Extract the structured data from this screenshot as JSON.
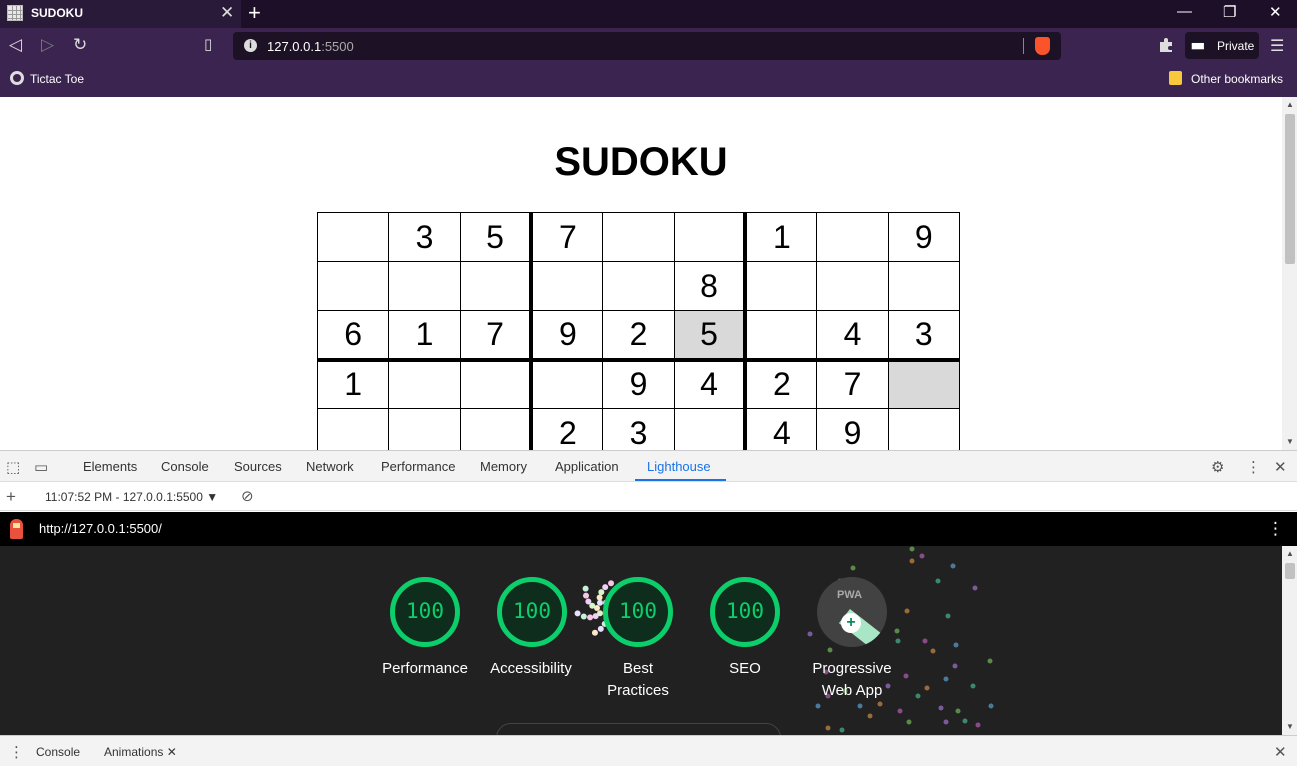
{
  "browser": {
    "tab_title": "SUDOKU",
    "tab_close": "✕",
    "new_tab": "+",
    "url_host": "127.0.0.1",
    "url_port": ":5500",
    "private_label": "Private",
    "bookmark_left": "Tictac Toe",
    "bookmark_right": "Other bookmarks"
  },
  "page": {
    "title": "SUDOKU",
    "rows": [
      [
        "",
        "3",
        "5",
        "7",
        "",
        "",
        "1",
        "",
        "9"
      ],
      [
        "",
        "",
        "",
        "",
        "",
        "8",
        "",
        "",
        ""
      ],
      [
        "6",
        "1",
        "7",
        "9",
        "2",
        "5",
        "",
        "4",
        "3"
      ],
      [
        "1",
        "",
        "",
        "",
        "9",
        "4",
        "2",
        "7",
        ""
      ],
      [
        "",
        "",
        "",
        "2",
        "3",
        "",
        "4",
        "9",
        ""
      ]
    ],
    "selected_cells": [
      "2-5",
      "3-8"
    ],
    "selected_color": "#d9d9d9"
  },
  "devtools": {
    "tabs": [
      "Elements",
      "Console",
      "Sources",
      "Network",
      "Performance",
      "Memory",
      "Application",
      "Lighthouse"
    ],
    "active_tab": "Lighthouse",
    "report_selector": "11:07:52 PM - 127.0.0.1:5500",
    "report_url": "http://127.0.0.1:5500/",
    "scores": [
      {
        "value": "100",
        "label_line1": "Performance",
        "label_line2": ""
      },
      {
        "value": "100",
        "label_line1": "Accessibility",
        "label_line2": ""
      },
      {
        "value": "100",
        "label_line1": "Best",
        "label_line2": "Practices"
      },
      {
        "value": "100",
        "label_line1": "SEO",
        "label_line2": ""
      }
    ],
    "pwa": {
      "badge_text": "PWA",
      "label_line1": "Progressive",
      "label_line2": "Web App"
    },
    "score_color": "#0cce6b",
    "drawer_tabs": [
      "Console",
      "Animations"
    ],
    "drawer_active": "Animations"
  }
}
